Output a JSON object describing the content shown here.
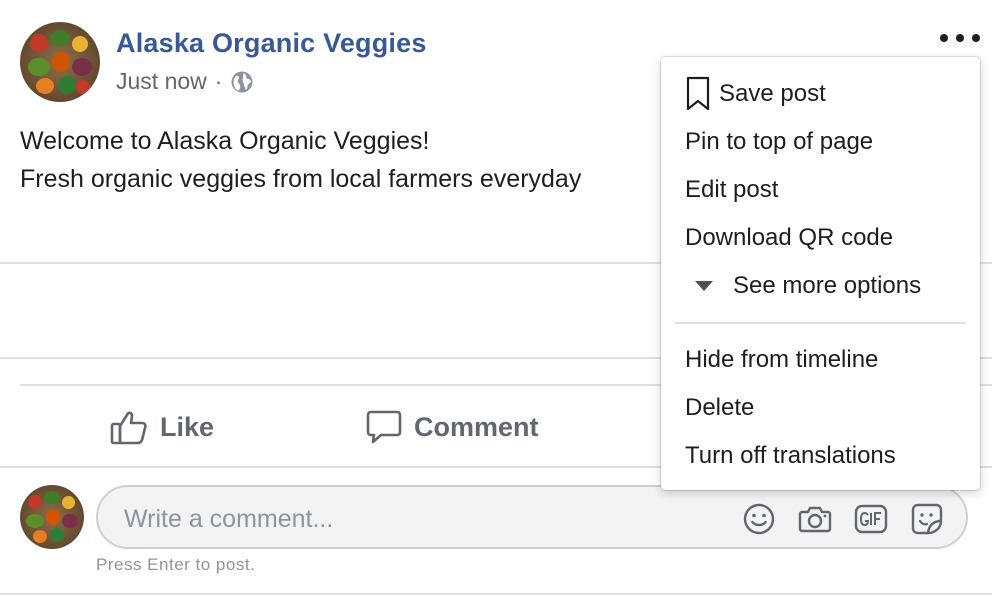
{
  "post": {
    "page_name": "Alaska Organic Veggies",
    "timestamp": "Just now",
    "separator": "·",
    "audience_icon": "globe-icon",
    "body_lines": [
      "Welcome to Alaska Organic Veggies!",
      "Fresh organic veggies from local farmers everyday"
    ]
  },
  "actions": {
    "like_label": "Like",
    "comment_label": "Comment"
  },
  "composer": {
    "placeholder": "Write a comment...",
    "hint": "Press Enter to post.",
    "icons": [
      "emoji-icon",
      "camera-icon",
      "gif-icon",
      "sticker-icon"
    ]
  },
  "menu": {
    "items": [
      {
        "label": "Save post",
        "icon": "bookmark-icon"
      },
      {
        "label": "Pin to top of page"
      },
      {
        "label": "Edit post"
      },
      {
        "label": "Download QR code"
      },
      {
        "label": "See more options",
        "icon": "caret-down-icon"
      },
      {
        "label": "Hide from timeline"
      },
      {
        "label": "Delete"
      },
      {
        "label": "Turn off translations"
      }
    ]
  },
  "colors": {
    "link_blue": "#385898",
    "secondary_text": "#606770",
    "divider": "#dddfe2"
  }
}
